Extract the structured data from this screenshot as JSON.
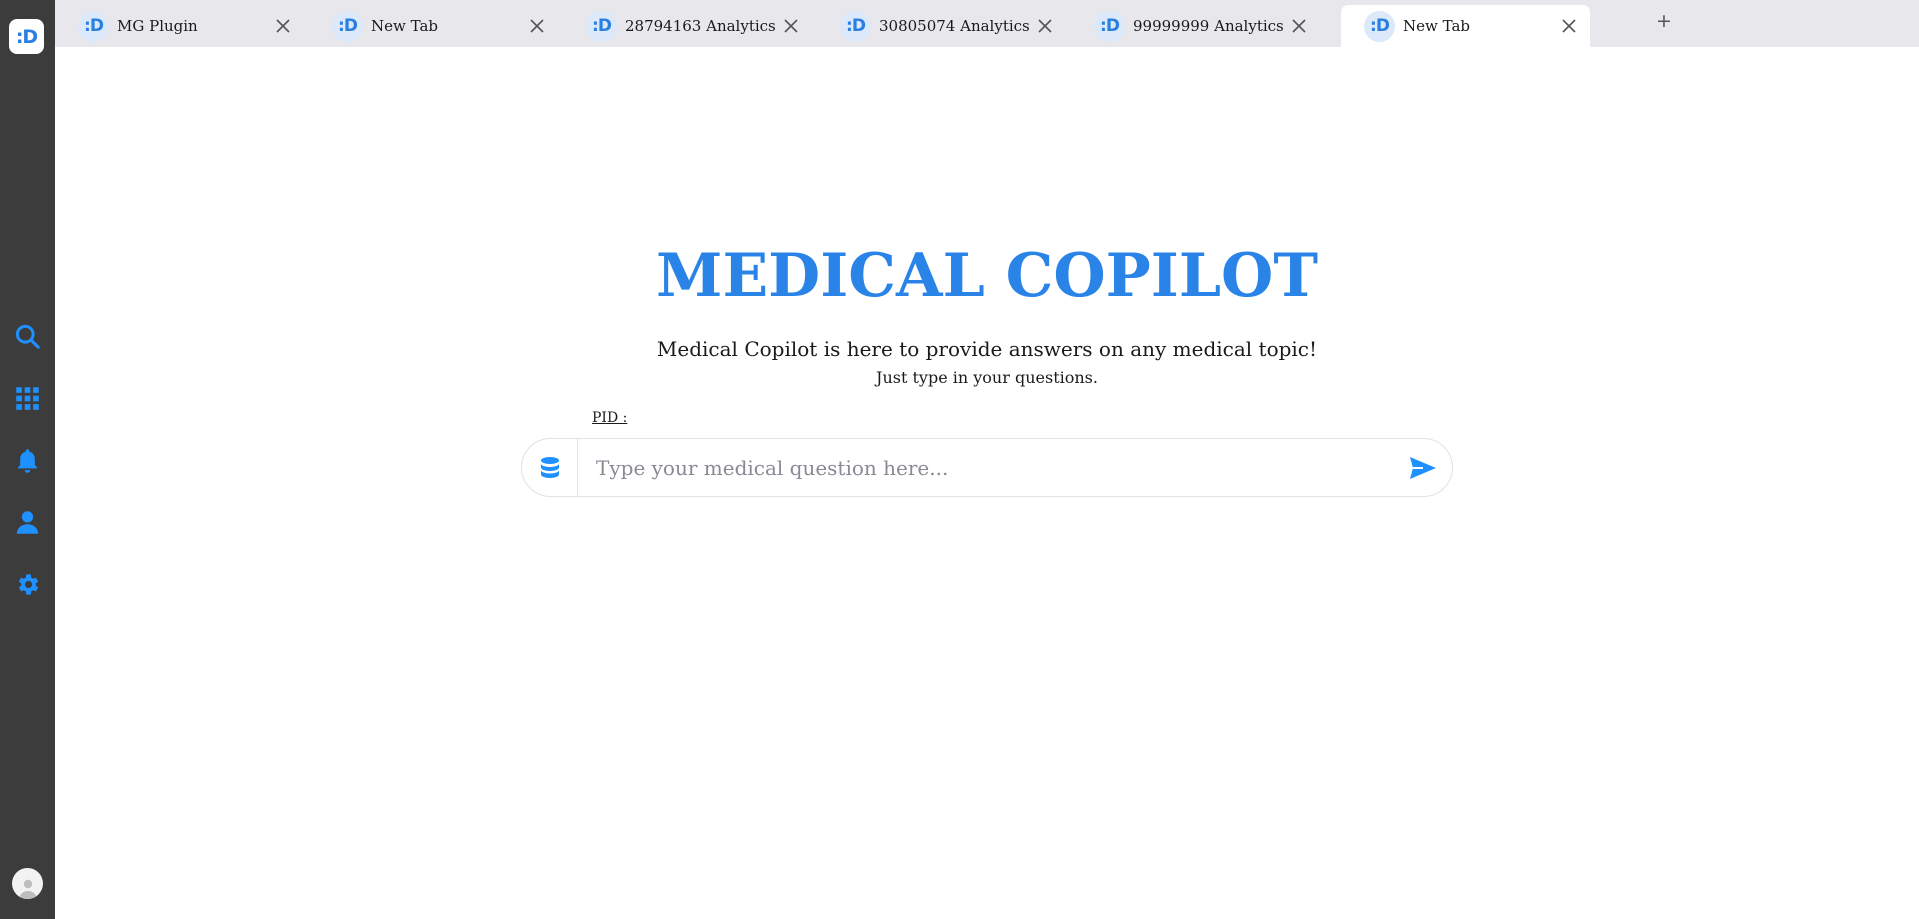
{
  "sidebar": {
    "logo_text": ":D",
    "icons": [
      "search-icon",
      "apps-grid-icon",
      "bell-icon",
      "user-icon",
      "gear-icon"
    ],
    "accent": "#1e90ff",
    "background": "#3c3c3c"
  },
  "tabs": [
    {
      "logo": ":D",
      "title": "MG Plugin",
      "active": false
    },
    {
      "logo": ":D",
      "title": "New Tab",
      "active": false
    },
    {
      "logo": ":D",
      "title": "28794163 Analytics",
      "active": false
    },
    {
      "logo": ":D",
      "title": "30805074 Analytics",
      "active": false
    },
    {
      "logo": ":D",
      "title": "99999999 Analytics",
      "active": false
    },
    {
      "logo": ":D",
      "title": "New Tab",
      "active": true
    }
  ],
  "new_tab_label": "+",
  "main": {
    "title": "MEDICAL COPILOT",
    "subtitle": "Medical Copilot is here to provide answers on any medical topic!",
    "subtitle2": "Just type in your questions.",
    "pid_label": "PID :",
    "search_placeholder": "Type your medical question here...",
    "search_value": ""
  },
  "colors": {
    "title": "#2a84e8",
    "accent": "#1e90ff"
  }
}
